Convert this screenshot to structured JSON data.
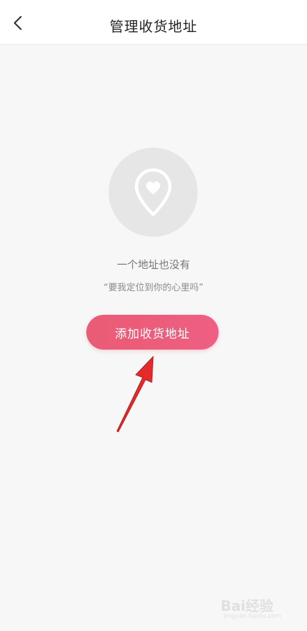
{
  "header": {
    "title": "管理收货地址",
    "back_icon": "chevron-left-icon"
  },
  "empty_state": {
    "icon": "location-heart-icon",
    "title": "一个地址也没有",
    "subtitle": "“要我定位到你的心里吗”"
  },
  "actions": {
    "add_address_label": "添加收货地址"
  },
  "annotation": {
    "arrow_color": "#e32b2b"
  },
  "watermark": {
    "text": "Bai经验",
    "sub": "jingyan.baidu.com"
  },
  "colors": {
    "accent_start": "#ea5b74",
    "accent_end": "#ee5f83",
    "background": "#f7f7f7"
  }
}
